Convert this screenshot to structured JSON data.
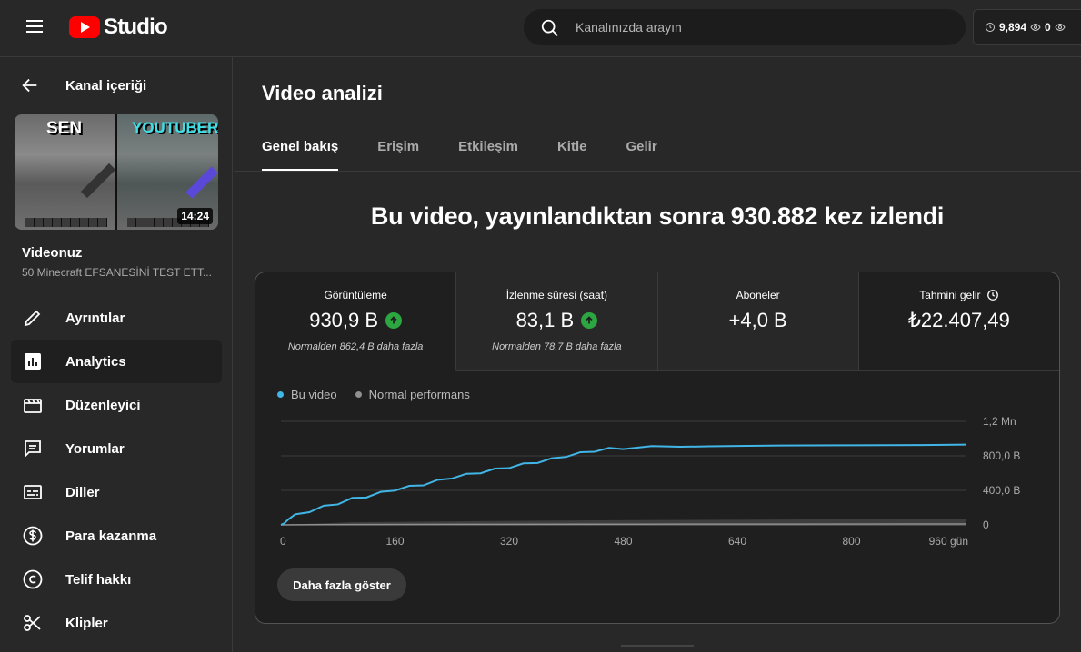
{
  "app": {
    "logo_text": "Studio"
  },
  "search": {
    "placeholder": "Kanalınızda arayın"
  },
  "header_stats": {
    "value1": "9,894",
    "value2": "0"
  },
  "sidebar": {
    "back_label": "Kanal içeriği",
    "thumb_text_left": "SEN",
    "thumb_text_right": "YOUTUBER",
    "duration": "14:24",
    "video_label": "Videonuz",
    "video_title": "50 Minecraft EFSANESİNİ TEST ETT...",
    "items": [
      {
        "label": "Ayrıntılar",
        "icon": "pencil-icon"
      },
      {
        "label": "Analytics",
        "icon": "analytics-icon"
      },
      {
        "label": "Düzenleyici",
        "icon": "clapperboard-icon"
      },
      {
        "label": "Yorumlar",
        "icon": "comment-icon"
      },
      {
        "label": "Diller",
        "icon": "subtitles-icon"
      },
      {
        "label": "Para kazanma",
        "icon": "dollar-icon"
      },
      {
        "label": "Telif hakkı",
        "icon": "copyright-icon"
      },
      {
        "label": "Klipler",
        "icon": "scissors-icon"
      }
    ],
    "active_item": "Analytics"
  },
  "main": {
    "title": "Video analizi",
    "tabs": [
      {
        "label": "Genel bakış",
        "active": true
      },
      {
        "label": "Erişim",
        "active": false
      },
      {
        "label": "Etkileşim",
        "active": false
      },
      {
        "label": "Kitle",
        "active": false
      },
      {
        "label": "Gelir",
        "active": false
      }
    ],
    "headline": "Bu video, yayınlandıktan sonra 930.882 kez izlendi",
    "metrics": [
      {
        "label": "Görüntüleme",
        "value": "930,9 B",
        "note": "Normalden 862,4 B daha fazla",
        "trend": "up"
      },
      {
        "label": "İzlenme süresi (saat)",
        "value": "83,1 B",
        "note": "Normalden 78,7 B daha fazla",
        "trend": "up"
      },
      {
        "label": "Aboneler",
        "value": "+4,0 B",
        "note": "",
        "trend": ""
      },
      {
        "label": "Tahmini gelir",
        "value": "₺22.407,49",
        "note": "",
        "trend": ""
      }
    ],
    "more_button": "Daha fazla göster"
  },
  "colors": {
    "accent": "#3ea6ff",
    "series": "#41b6e6",
    "normal": "#909090",
    "up": "#2ba640",
    "brand": "#ff0000"
  },
  "chart_data": {
    "type": "line",
    "legend": [
      "Bu video",
      "Normal performans"
    ],
    "x_ticks": [
      "0",
      "160",
      "320",
      "480",
      "640",
      "800",
      "960 gün"
    ],
    "y_ticks": [
      "0",
      "400,0 B",
      "800,0 B",
      "1,2 Mn"
    ],
    "xlim": [
      0,
      960
    ],
    "ylim": [
      0,
      1200000
    ],
    "series": [
      {
        "name": "Bu video",
        "x": [
          0,
          5,
          10,
          20,
          40,
          60,
          80,
          100,
          120,
          140,
          160,
          180,
          200,
          220,
          240,
          260,
          280,
          300,
          320,
          340,
          360,
          380,
          400,
          420,
          440,
          460,
          480,
          520,
          560,
          600,
          640,
          700,
          800,
          900,
          960
        ],
        "y": [
          0,
          20000,
          60000,
          110000,
          160000,
          210000,
          250000,
          300000,
          330000,
          370000,
          410000,
          440000,
          470000,
          510000,
          550000,
          580000,
          610000,
          640000,
          670000,
          700000,
          730000,
          760000,
          800000,
          830000,
          860000,
          880000,
          890000,
          900000,
          905000,
          910000,
          915000,
          920000,
          922000,
          925000,
          930882
        ]
      },
      {
        "name": "Normal performans",
        "x": [
          0,
          20,
          100,
          300,
          500,
          700,
          960
        ],
        "y": [
          0,
          8000,
          30000,
          45000,
          55000,
          62000,
          68500
        ]
      }
    ]
  }
}
